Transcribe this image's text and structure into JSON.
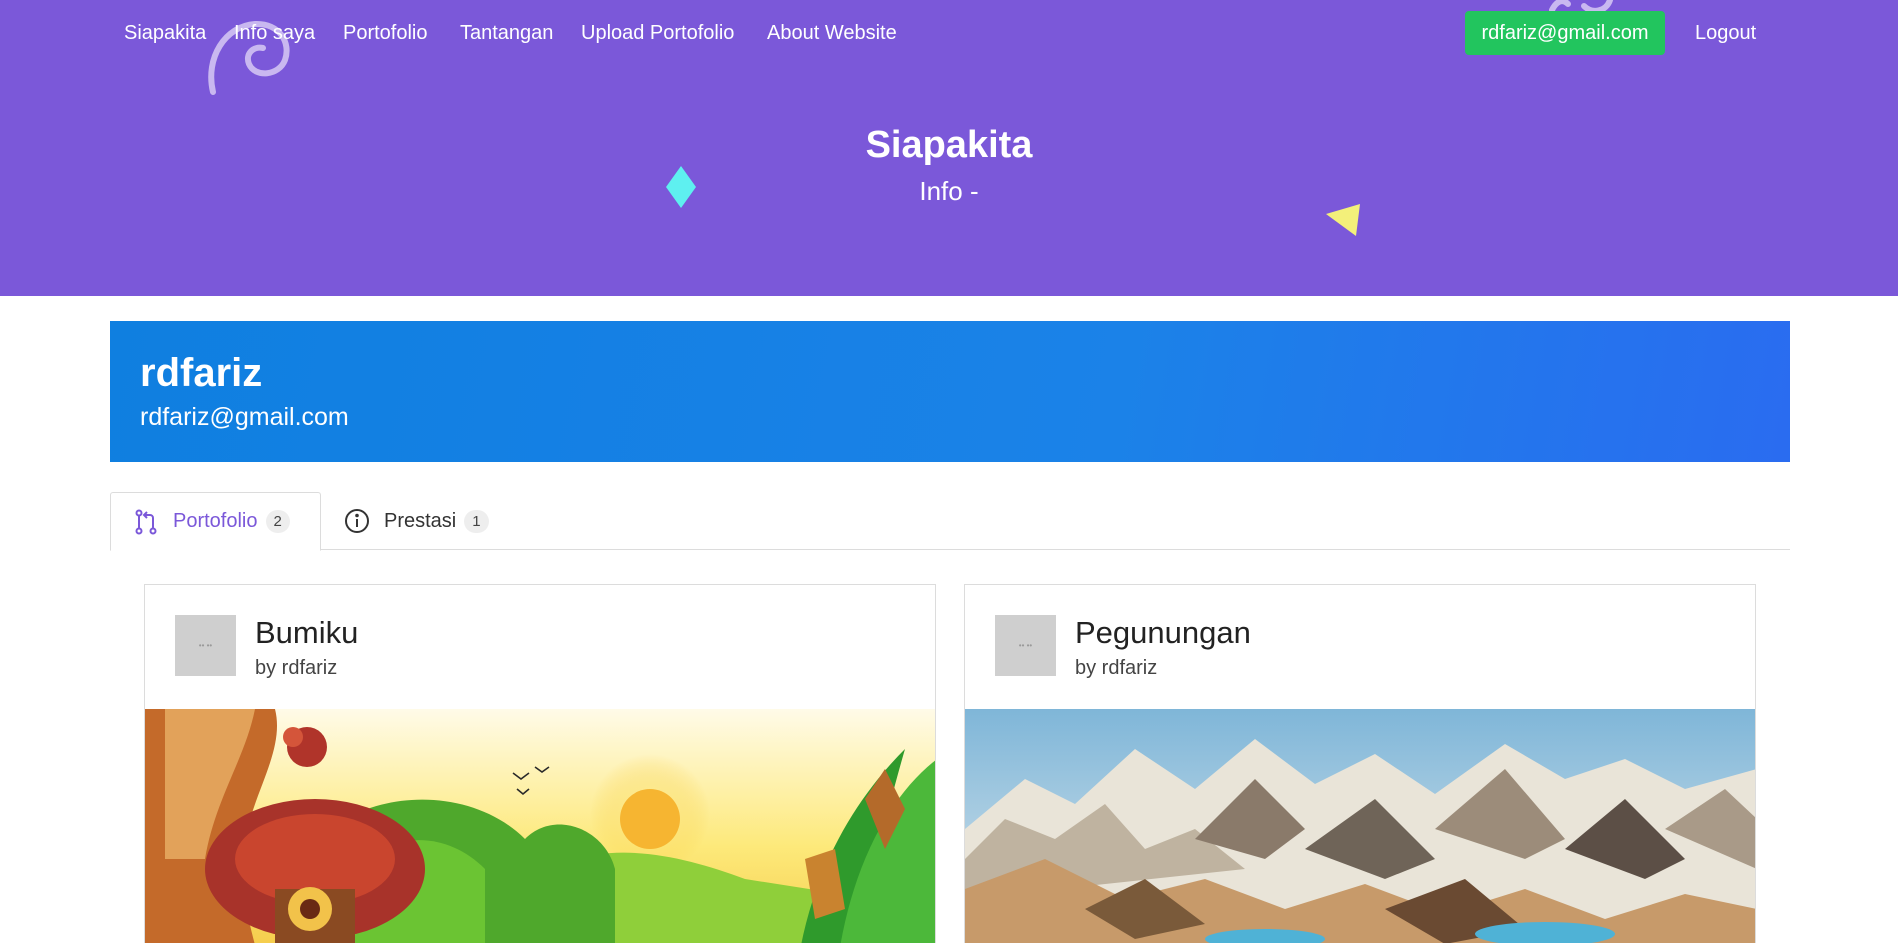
{
  "nav": {
    "items": [
      {
        "label": "Siapakita"
      },
      {
        "label": "Info saya"
      },
      {
        "label": "Portofolio"
      },
      {
        "label": "Tantangan"
      },
      {
        "label": "Upload Portofolio"
      },
      {
        "label": "About Website"
      }
    ],
    "user_email": "rdfariz@gmail.com",
    "logout_label": "Logout"
  },
  "hero": {
    "title": "Siapakita",
    "subtitle": "Info -"
  },
  "profile": {
    "name": "rdfariz",
    "email": "rdfariz@gmail.com"
  },
  "tabs": [
    {
      "label": "Portofolio",
      "count": "2",
      "icon": "git-pull-request-icon",
      "active": true
    },
    {
      "label": "Prestasi",
      "count": "1",
      "icon": "info-circle-icon",
      "active": false
    }
  ],
  "cards": [
    {
      "title": "Bumiku",
      "author": "by rdfariz",
      "avatar_text": "•• ••",
      "image": "fantasy-forest-landscape"
    },
    {
      "title": "Pegunungan",
      "author": "by rdfariz",
      "avatar_text": "•• ••",
      "image": "low-poly-mountains"
    }
  ],
  "colors": {
    "header_bg": "#7b58d9",
    "email_button": "#22c55e",
    "banner": "#1b82e8",
    "accent": "#7b58d9"
  }
}
